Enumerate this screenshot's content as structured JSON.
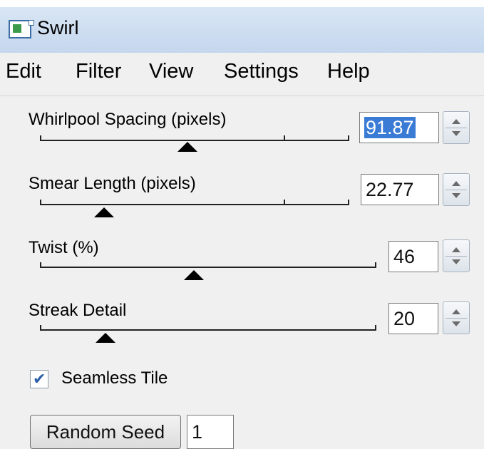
{
  "window": {
    "title": "Swirl",
    "icon": "app-icon"
  },
  "menu": {
    "items": [
      "Edit",
      "Filter",
      "View",
      "Settings",
      "Help"
    ]
  },
  "sliders": [
    {
      "label": "Whirlpool Spacing (pixels)",
      "value": "91.87",
      "selected": true
    },
    {
      "label": "Smear Length (pixels)",
      "value": "22.77",
      "selected": false
    },
    {
      "label": "Twist (%)",
      "value": "46",
      "selected": false
    },
    {
      "label": "Streak Detail",
      "value": "20",
      "selected": false
    }
  ],
  "seamless_tile": {
    "label": "Seamless Tile",
    "checked": true
  },
  "random_seed": {
    "button_label": "Random Seed",
    "value": "1"
  },
  "colors": {
    "title_bar": "#c4d7ee",
    "selection": "#3a7bd5",
    "background": "#f0f0f0"
  }
}
